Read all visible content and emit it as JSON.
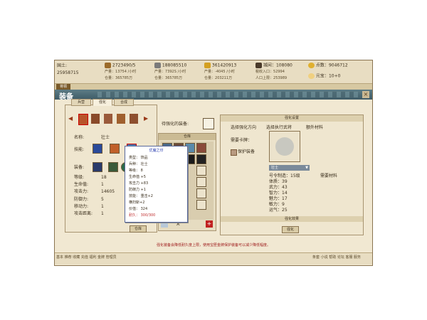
{
  "resources": {
    "left_top_label": "国土:",
    "left_top_value": "25958715",
    "food_amount": "2723490/5",
    "food_rate_label": "产量：",
    "food_rate": "13754 /小时",
    "food_store_label": "仓量：",
    "food_store": "365785万",
    "iron_amount": "188085510",
    "iron_rate_label": "产量：",
    "iron_rate": "7392S /小时",
    "iron_store_label": "仓量：",
    "iron_store": "365785万",
    "gold_amount": "361420913",
    "gold_rate_label": "产量：",
    "gold_rate": "-4045 /小时",
    "gold_store_label": "仓量：",
    "gold_store": "203211万",
    "pop_label": "城间：",
    "pop_value": "108080",
    "pop_income_label": "税收入口：",
    "pop_income": "52994",
    "pop_limit_label": "人口上限：",
    "pop_limit": "253989",
    "points_label": "点数：",
    "points_value": "9046712",
    "vip_label": "元宝：",
    "vip_value": "10+0"
  },
  "top_tab": "将领",
  "window_title": "装备",
  "tabs": [
    "兵营",
    "强化",
    "合成"
  ],
  "hero": {
    "name_label": "名称:",
    "name_value": "壮士",
    "skill_label": "技能:",
    "equip_label": "装备:",
    "stats": [
      {
        "label": "等级:",
        "value": "18"
      },
      {
        "label": "生命值:",
        "value": "1"
      },
      {
        "label": "攻击力:",
        "value": "14605"
      },
      {
        "label": "防御力:",
        "value": "5"
      },
      {
        "label": "移动力:",
        "value": "1"
      },
      {
        "label": "攻击距离:",
        "value": "1"
      }
    ],
    "warehouse_btn": "仓库"
  },
  "to_enhance_label": "待强化的装备:",
  "warehouse": {
    "title": "仓库",
    "page_text": "1/1"
  },
  "tooltip": {
    "title": "优魔之印",
    "rows": [
      "类型：   饰品",
      "兵种：   壮士",
      "等级：   8",
      "   生命值 +5",
      "   攻击力 +83",
      "   防御力 +1",
      "技能：  重击+2",
      "        横扫斩+2",
      "价值：   324",
      "耐久：   300/300"
    ]
  },
  "enhance": {
    "settings_title": "强化设置",
    "choose_dir": "选择强化方向",
    "choose_attr": "选择执行武将",
    "extra_materials": "额外材料",
    "need_item": "需要卡牌：",
    "protect_label": "保护装备",
    "hero_select": "壮士",
    "material_need": "需要材料",
    "attrs": [
      {
        "label": "号令制造：",
        "value": "15级"
      },
      {
        "label": "体质：",
        "value": "39"
      },
      {
        "label": "武力：",
        "value": "43"
      },
      {
        "label": "智力：",
        "value": "14"
      },
      {
        "label": "魅力：",
        "value": "17"
      },
      {
        "label": "敏力：",
        "value": "9"
      },
      {
        "label": "运气：",
        "value": "25"
      }
    ],
    "effect_title": "强化效果",
    "enhance_btn": "强化"
  },
  "note": "强化装备会降低耐久度上限，使用宝匣金牌保护装备可以减少降低幅度。",
  "footer_left": [
    "基本",
    "推荐",
    "收藏",
    "充值",
    "福利",
    "金牌",
    "管理员"
  ],
  "footer_right": [
    "条套",
    "小说",
    "帮助",
    "论坛",
    "客服",
    "服务"
  ],
  "colors": {
    "frame_bg": "#f1e8d2",
    "title_bar": "#3f5b66",
    "note_red": "#a02020",
    "tooltip_title": "#2a3eb0",
    "durability_red": "#c03030"
  }
}
